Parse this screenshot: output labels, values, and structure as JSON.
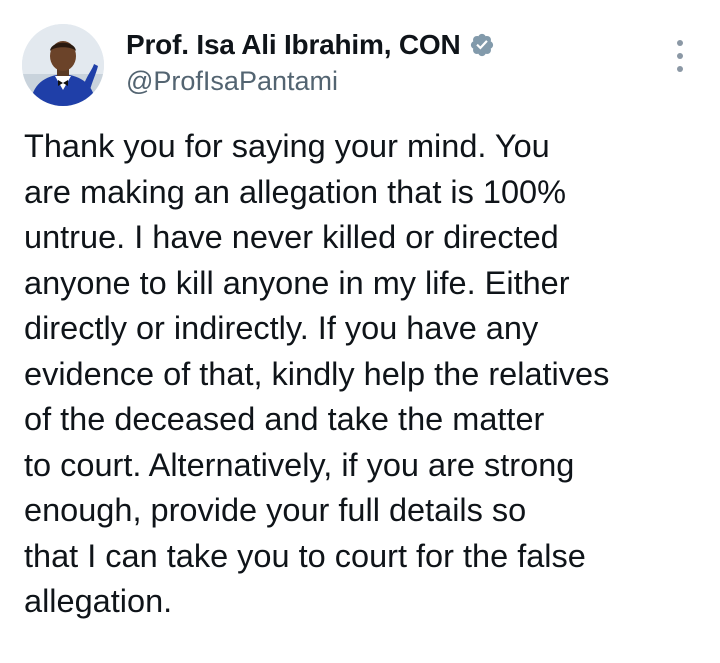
{
  "author": {
    "display_name": "Prof. Isa Ali Ibrahim, CON",
    "handle": "@ProfIsaPantami",
    "verified": true,
    "avatar_icon": "profile-photo",
    "verified_icon": "verified-badge-icon",
    "verified_color": "#829aab"
  },
  "menu": {
    "more_icon": "more-options-icon"
  },
  "tweet": {
    "lines": [
      "Thank you for saying your mind. You",
      "are making an allegation that is 100%",
      "untrue. I have never killed or directed",
      "anyone to kill anyone in my life. Either",
      "directly or indirectly. If you have any",
      "evidence of that, kindly help the relatives",
      "of the deceased and take the matter",
      "to court. Alternatively, if you are strong",
      "enough, provide your full details so",
      "that I can take you to court for the false",
      "allegation."
    ]
  }
}
